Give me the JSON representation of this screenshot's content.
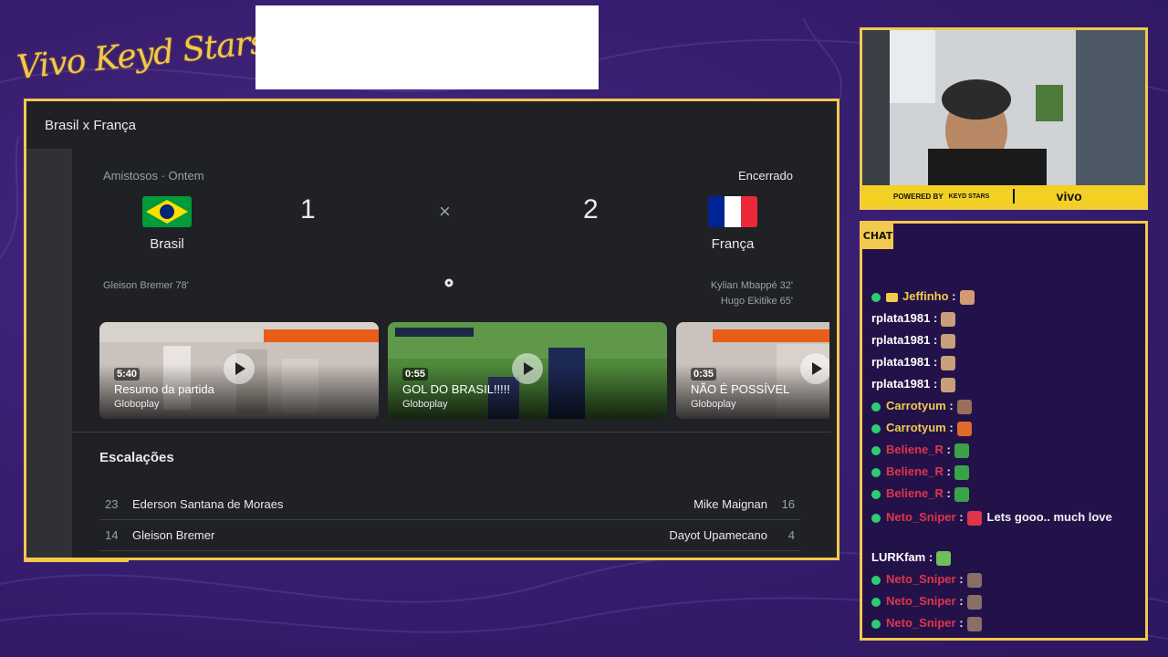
{
  "overlay": {
    "brand": "Vivo Keyd Stars"
  },
  "google": {
    "header_title": "Brasil x França",
    "competition": "Amistosos",
    "when": "Ontem",
    "status": "Encerrado",
    "home": {
      "name": "Brasil",
      "score": "1",
      "scorers": [
        "Gleison Bremer 78'"
      ]
    },
    "away": {
      "name": "França",
      "score": "2",
      "scorers": [
        "Kylian Mbappé 32'",
        "Hugo Ekitike 65'"
      ]
    },
    "vs_symbol": "×",
    "videos": [
      {
        "duration": "5:40",
        "title": "Resumo da partida",
        "source": "Globoplay"
      },
      {
        "duration": "0:55",
        "title": "GOL DO BRASIL!!!!!",
        "source": "Globoplay"
      },
      {
        "duration": "0:35",
        "title": "NÃO É POSSÍVEL",
        "source": "Globoplay"
      }
    ],
    "lineups_title": "Escalações",
    "lineups": [
      {
        "home_no": "23",
        "home_player": "Ederson Santana de Moraes",
        "away_player": "Mike Maignan",
        "away_no": "16"
      },
      {
        "home_no": "14",
        "home_player": "Gleison Bremer",
        "away_player": "Dayot Upamecano",
        "away_no": "4"
      }
    ]
  },
  "webcam": {
    "powered_by": "POWERED BY",
    "sponsor_small": "KEYD STARS",
    "sponsor_logo": "vivo"
  },
  "chat": {
    "tag": "CHAT",
    "messages": [
      {
        "user": "Jeffinho",
        "color": "yellow",
        "badge": "crown",
        "text": ""
      },
      {
        "user": "rplata1981",
        "color": "white",
        "badge": "",
        "text": ""
      },
      {
        "user": "rplata1981",
        "color": "white",
        "badge": "",
        "text": ""
      },
      {
        "user": "rplata1981",
        "color": "white",
        "badge": "",
        "text": ""
      },
      {
        "user": "rplata1981",
        "color": "white",
        "badge": "",
        "text": ""
      },
      {
        "user": "Carrotyum",
        "color": "yellow",
        "badge": "dot",
        "text": ""
      },
      {
        "user": "Carrotyum",
        "color": "yellow",
        "badge": "dot",
        "text": ""
      },
      {
        "user": "Beliene_R",
        "color": "red",
        "badge": "dot",
        "text": ""
      },
      {
        "user": "Beliene_R",
        "color": "red",
        "badge": "dot",
        "text": ""
      },
      {
        "user": "Beliene_R",
        "color": "red",
        "badge": "dot",
        "text": ""
      },
      {
        "user": "Neto_Sniper",
        "color": "red",
        "badge": "dot",
        "text": "Lets gooo.. much love"
      },
      {
        "user": "LURKfam",
        "color": "white",
        "badge": "",
        "text": ""
      },
      {
        "user": "Neto_Sniper",
        "color": "red",
        "badge": "dot",
        "text": ""
      },
      {
        "user": "Neto_Sniper",
        "color": "red",
        "badge": "dot",
        "text": ""
      },
      {
        "user": "Neto_Sniper",
        "color": "red",
        "badge": "dot",
        "text": ""
      }
    ]
  },
  "colors": {
    "accent": "#f2c94c",
    "bg": "#3a1f73",
    "panel": "#202124"
  }
}
